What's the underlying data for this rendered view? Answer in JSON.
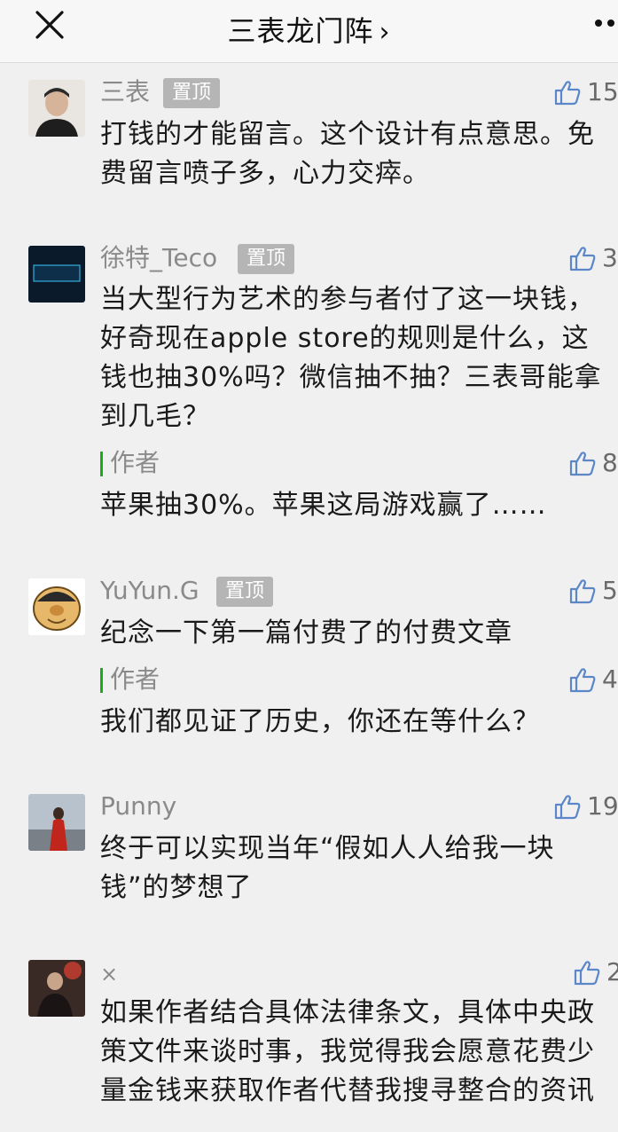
{
  "header": {
    "title": "三表龙门阵",
    "close_icon": "close-icon",
    "more_icon": "more-icon"
  },
  "comments": [
    {
      "name": "三表",
      "pin": "置顶",
      "likes": "15",
      "text": "打钱的才能留言。这个设计有点意思。免费留言喷子多，心力交瘁。"
    },
    {
      "name": "徐特_Teco",
      "pin": "置顶",
      "likes": "3",
      "text": "当大型行为艺术的参与者付了这一块钱，好奇现在apple store的规则是什么，这钱也抽30%吗？微信抽不抽？三表哥能拿到几毛？",
      "reply": {
        "label": "作者",
        "likes": "8",
        "text": "苹果抽30%。苹果这局游戏赢了……"
      }
    },
    {
      "name": "YuYun.G",
      "pin": "置顶",
      "likes": "5",
      "text": "纪念一下第一篇付费了的付费文章",
      "reply": {
        "label": "作者",
        "likes": "4",
        "text": "我们都见证了历史，你还在等什么？"
      }
    },
    {
      "name": "Punny",
      "likes": "19",
      "text": "终于可以实现当年“假如人人给我一块钱”的梦想了"
    },
    {
      "name": "×",
      "likes": "2",
      "text": "如果作者结合具体法律条文，具体中央政策文件来谈时事，我觉得我会愿意花费少量金钱来获取作者代替我搜寻整合的资讯"
    }
  ],
  "icons": {
    "like": "thumbs-up-icon"
  }
}
